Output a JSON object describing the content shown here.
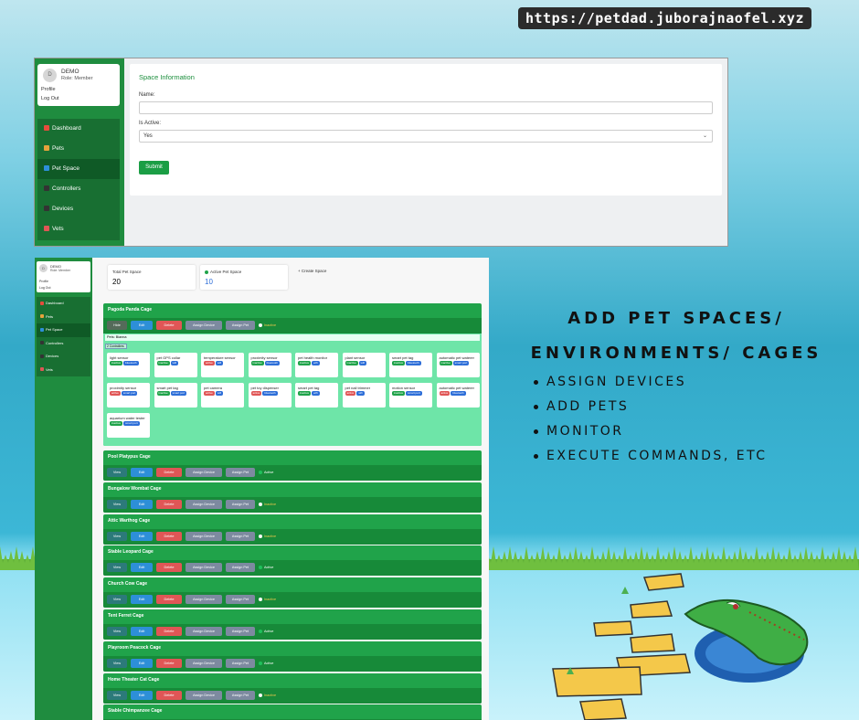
{
  "site_url": "https://petdad.juborajnaofel.xyz",
  "form_screen": {
    "user": {
      "avatar_initial": "D",
      "name": "DEMO",
      "role": "Role: Member",
      "profile": "Profile",
      "logout": "Log Out"
    },
    "nav": [
      {
        "label": "Dashboard",
        "icon": "dashboard-icon",
        "color": "#e74c3c"
      },
      {
        "label": "Pets",
        "icon": "pets-icon",
        "color": "#e6a23c"
      },
      {
        "label": "Pet Space",
        "icon": "pet-space-icon",
        "color": "#2d8fd8"
      },
      {
        "label": "Controllers",
        "icon": "controllers-icon",
        "color": "#333333"
      },
      {
        "label": "Devices",
        "icon": "devices-icon",
        "color": "#333333"
      },
      {
        "label": "Vets",
        "icon": "vets-icon",
        "color": "#e05656"
      }
    ],
    "card_title": "Space Information",
    "name_label": "Name:",
    "name_value": "",
    "active_label": "Is Active:",
    "active_value": "Yes",
    "submit_label": "Submit"
  },
  "list_screen": {
    "user": {
      "avatar_initial": "D",
      "name": "DEMO",
      "role": "Role: Member",
      "profile": "Profile",
      "logout": "Log Out"
    },
    "nav": [
      {
        "label": "Dashboard",
        "color": "#e74c3c"
      },
      {
        "label": "Pets",
        "color": "#e6a23c"
      },
      {
        "label": "Pet Space",
        "color": "#2d8fd8"
      },
      {
        "label": "Controllers",
        "color": "#333333"
      },
      {
        "label": "Devices",
        "color": "#333333"
      },
      {
        "label": "Vets",
        "color": "#e05656"
      }
    ],
    "total_label": "Total Pet Space",
    "total_value": "20",
    "active_label": "Active Pet Space",
    "active_value": "10",
    "create_label": "Create Space",
    "buttons": {
      "hide": "Hide",
      "view": "View",
      "edit": "Edit",
      "delete": "Delete",
      "assign_device": "Assign Device",
      "assign_pet": "Assign Pet"
    },
    "expanded_cage": {
      "name": "Pagoda Panda Cage",
      "status": "Inactive",
      "pets_line": "Pets: Bianna",
      "controllers_label": "2 Controllers",
      "devices": [
        {
          "name": "light sensor",
          "tags": [
            "inactive",
            "bluetooth"
          ]
        },
        {
          "name": "pet GPS collar",
          "tags": [
            "inactive",
            "wifi"
          ]
        },
        {
          "name": "temperature sensor",
          "tags": [
            "active",
            "wifi"
          ]
        },
        {
          "name": "proximity sensor",
          "tags": [
            "inactive",
            "bluetooth"
          ]
        },
        {
          "name": "pet health monitor",
          "tags": [
            "inactive",
            "wifi"
          ]
        },
        {
          "name": "plant sensor",
          "tags": [
            "inactive",
            "wifi"
          ]
        },
        {
          "name": "smart pet tag",
          "tags": [
            "inactive",
            "bluetooth"
          ]
        },
        {
          "name": "automatic pet waterer",
          "tags": [
            "inactive",
            "smart port"
          ]
        },
        {
          "name": "proximity sensor",
          "tags": [
            "active",
            "smart port"
          ]
        },
        {
          "name": "smart pet tag",
          "tags": [
            "inactive",
            "smart port"
          ]
        },
        {
          "name": "pet camera",
          "tags": [
            "active",
            "wifi"
          ]
        },
        {
          "name": "pet toy dispenser",
          "tags": [
            "active",
            "bluetooth"
          ]
        },
        {
          "name": "smart pet tag",
          "tags": [
            "inactive",
            "wifi"
          ]
        },
        {
          "name": "pet nail trimmer",
          "tags": [
            "active",
            "wifi"
          ]
        },
        {
          "name": "motion sensor",
          "tags": [
            "inactive",
            "smart port"
          ]
        },
        {
          "name": "automatic pet waterer",
          "tags": [
            "active",
            "bluetooth"
          ]
        },
        {
          "name": "aquarium water tester",
          "tags": [
            "inactive",
            "smart port"
          ]
        }
      ]
    },
    "cages": [
      {
        "name": "Pool Platypus Cage",
        "status": "Active"
      },
      {
        "name": "Bungalow Wombat Cage",
        "status": "Inactive"
      },
      {
        "name": "Attic Warthog Cage",
        "status": "Inactive"
      },
      {
        "name": "Stable Leopard Cage",
        "status": "Active"
      },
      {
        "name": "Church Cow Cage",
        "status": "Inactive"
      },
      {
        "name": "Tent Ferret Cage",
        "status": "Active"
      },
      {
        "name": "Playroom Peacock Cage",
        "status": "Active"
      },
      {
        "name": "Home Theater Cat Cage",
        "status": "Inactive"
      },
      {
        "name": "Stable Chimpanzee Cage",
        "status": ""
      }
    ],
    "tag_colors": {
      "active": "#e05656",
      "inactive": "#20a34a",
      "wifi": "#2d6ed8",
      "bluetooth": "#2d6ed8",
      "smart port": "#2d6ed8"
    },
    "status_colors": {
      "Active": "#20c05c",
      "Inactive": "#ffffff"
    }
  },
  "heading_lines": [
    "ADD PET SPACES/",
    "ENVIRONMENTS/ CAGES"
  ],
  "bullets": [
    "ASSIGN DEVICES",
    "ADD PETS",
    "MONITOR",
    "EXECUTE COMMANDS, ETC"
  ]
}
